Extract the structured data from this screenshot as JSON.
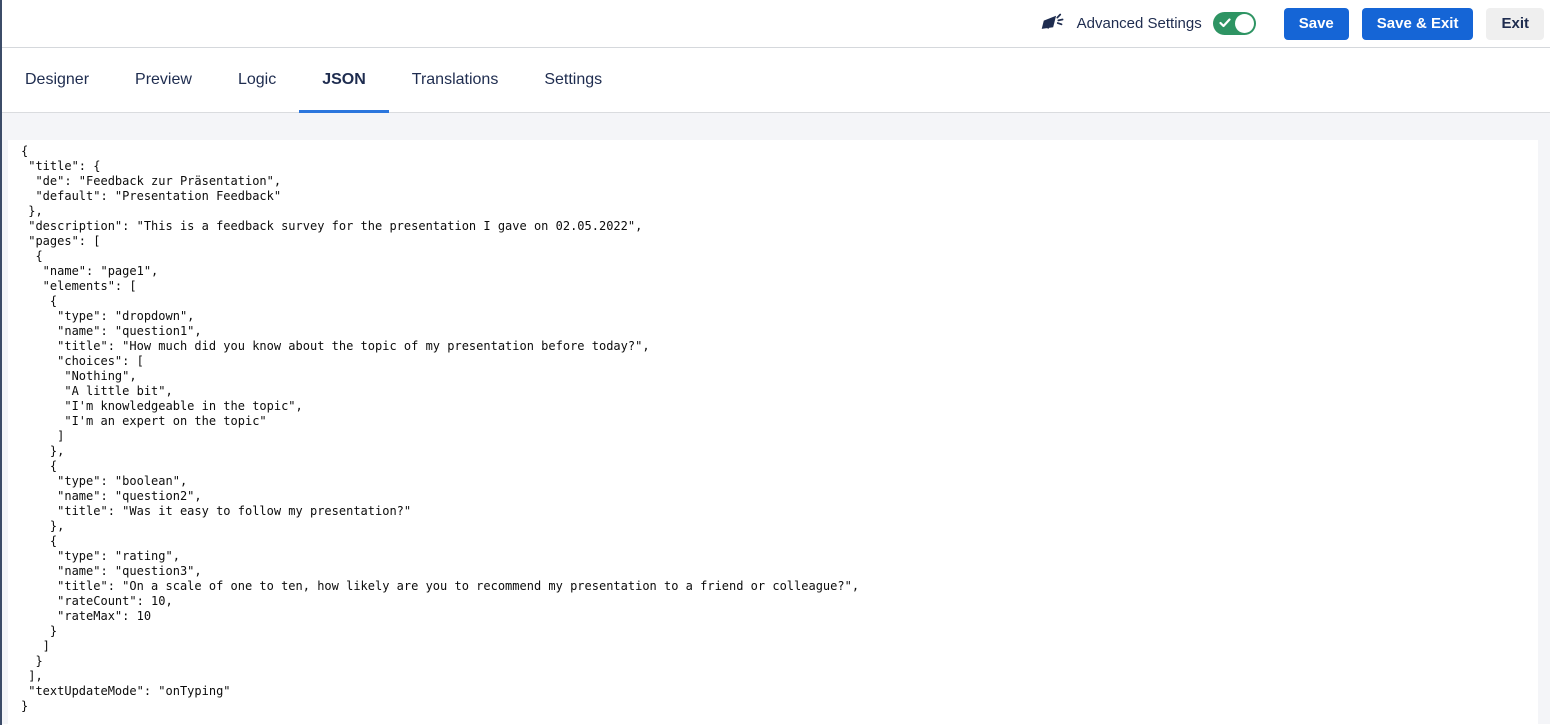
{
  "header": {
    "icon": "megaphone",
    "advanced_settings_label": "Advanced Settings",
    "advanced_settings_state": "on",
    "save_label": "Save",
    "save_exit_label": "Save & Exit",
    "exit_label": "Exit"
  },
  "tabs": [
    {
      "label": "Designer",
      "active": false
    },
    {
      "label": "Preview",
      "active": false
    },
    {
      "label": "Logic",
      "active": false
    },
    {
      "label": "JSON",
      "active": true
    },
    {
      "label": "Translations",
      "active": false
    },
    {
      "label": "Settings",
      "active": false
    }
  ],
  "editor": {
    "language": "json",
    "content": "{\n \"title\": {\n  \"de\": \"Feedback zur Präsentation\",\n  \"default\": \"Presentation Feedback\"\n },\n \"description\": \"This is a feedback survey for the presentation I gave on 02.05.2022\",\n \"pages\": [\n  {\n   \"name\": \"page1\",\n   \"elements\": [\n    {\n     \"type\": \"dropdown\",\n     \"name\": \"question1\",\n     \"title\": \"How much did you know about the topic of my presentation before today?\",\n     \"choices\": [\n      \"Nothing\",\n      \"A little bit\",\n      \"I'm knowledgeable in the topic\",\n      \"I'm an expert on the topic\"\n     ]\n    },\n    {\n     \"type\": \"boolean\",\n     \"name\": \"question2\",\n     \"title\": \"Was it easy to follow my presentation?\"\n    },\n    {\n     \"type\": \"rating\",\n     \"name\": \"question3\",\n     \"title\": \"On a scale of one to ten, how likely are you to recommend my presentation to a friend or colleague?\",\n     \"rateCount\": 10,\n     \"rateMax\": 10\n    }\n   ]\n  }\n ],\n \"textUpdateMode\": \"onTyping\"\n}"
  },
  "colors": {
    "primary_blue": "#1565d6",
    "tab_underline_blue": "#2b76dd",
    "toggle_green": "#2e9463",
    "text_navy": "#1e2c4f",
    "content_bg": "#f4f5f8"
  }
}
